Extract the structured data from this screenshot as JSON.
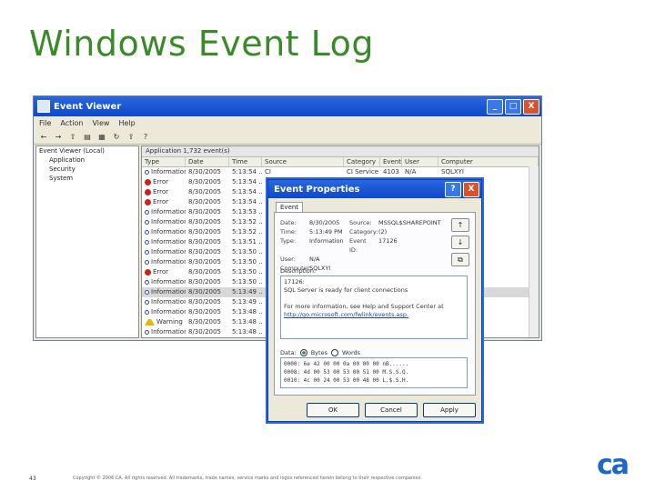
{
  "slide": {
    "title": "Windows Event Log",
    "page_number": "43",
    "copyright": "Copyright © 2006 CA. All rights reserved. All trademarks, trade names, service marks and logos referenced herein belong to their respective companies.",
    "logo_text": "ca"
  },
  "event_viewer": {
    "title": "Event Viewer",
    "window_buttons": {
      "minimize": "_",
      "maximize": "□",
      "close": "X"
    },
    "menu": [
      "File",
      "Action",
      "View",
      "Help"
    ],
    "tree": {
      "root": "Event Viewer (Local)",
      "items": [
        "Application",
        "Security",
        "System"
      ]
    },
    "list_info": "Application    1,732 event(s)",
    "columns": [
      "Type",
      "Date",
      "Time",
      "Source",
      "Category",
      "Event",
      "User",
      "Computer"
    ],
    "rows": [
      {
        "type": "Information",
        "icon": "info",
        "date": "8/30/2005",
        "time": "5:13:54 ...",
        "source": "CI",
        "category": "CI Service",
        "event": "4103",
        "user": "N/A",
        "computer": "SQLXYI"
      },
      {
        "type": "Error",
        "icon": "error",
        "date": "8/30/2005",
        "time": "5:13:54 ...",
        "source": "",
        "category": "",
        "event": "",
        "user": "",
        "computer": ""
      },
      {
        "type": "Error",
        "icon": "error",
        "date": "8/30/2005",
        "time": "5:13:54 ...",
        "source": "",
        "category": "",
        "event": "",
        "user": "",
        "computer": ""
      },
      {
        "type": "Error",
        "icon": "error",
        "date": "8/30/2005",
        "time": "5:13:54 ...",
        "source": "",
        "category": "",
        "event": "",
        "user": "",
        "computer": ""
      },
      {
        "type": "Information",
        "icon": "info",
        "date": "8/30/2005",
        "time": "5:13:53 ...",
        "source": "",
        "category": "",
        "event": "",
        "user": "",
        "computer": ""
      },
      {
        "type": "Information",
        "icon": "info",
        "date": "8/30/2005",
        "time": "5:13:52 ...",
        "source": "",
        "category": "",
        "event": "",
        "user": "",
        "computer": ""
      },
      {
        "type": "Information",
        "icon": "info",
        "date": "8/30/2005",
        "time": "5:13:52 ...",
        "source": "",
        "category": "",
        "event": "",
        "user": "",
        "computer": ""
      },
      {
        "type": "Information",
        "icon": "info",
        "date": "8/30/2005",
        "time": "5:13:51 ...",
        "source": "",
        "category": "",
        "event": "",
        "user": "",
        "computer": ""
      },
      {
        "type": "Information",
        "icon": "info",
        "date": "8/30/2005",
        "time": "5:13:50 ...",
        "source": "",
        "category": "",
        "event": "",
        "user": "",
        "computer": ""
      },
      {
        "type": "Information",
        "icon": "info",
        "date": "8/30/2005",
        "time": "5:13:50 ...",
        "source": "",
        "category": "",
        "event": "",
        "user": "",
        "computer": ""
      },
      {
        "type": "Error",
        "icon": "error",
        "date": "8/30/2005",
        "time": "5:13:50 ...",
        "source": "",
        "category": "",
        "event": "",
        "user": "",
        "computer": ""
      },
      {
        "type": "Information",
        "icon": "info",
        "date": "8/30/2005",
        "time": "5:13:50 ...",
        "source": "",
        "category": "",
        "event": "",
        "user": "",
        "computer": ""
      },
      {
        "type": "Information",
        "icon": "info",
        "date": "8/30/2005",
        "time": "5:13:49 ...",
        "source": "",
        "category": "",
        "event": "",
        "user": "",
        "computer": "",
        "selected": true
      },
      {
        "type": "Information",
        "icon": "info",
        "date": "8/30/2005",
        "time": "5:13:49 ...",
        "source": "",
        "category": "",
        "event": "",
        "user": "",
        "computer": ""
      },
      {
        "type": "Information",
        "icon": "info",
        "date": "8/30/2005",
        "time": "5:13:48 ...",
        "source": "",
        "category": "",
        "event": "",
        "user": "",
        "computer": ""
      },
      {
        "type": "Warning",
        "icon": "warning",
        "date": "8/30/2005",
        "time": "5:13:48 ...",
        "source": "",
        "category": "",
        "event": "",
        "user": "",
        "computer": ""
      },
      {
        "type": "Information",
        "icon": "info",
        "date": "8/30/2005",
        "time": "5:13:48 ...",
        "source": "",
        "category": "",
        "event": "",
        "user": "",
        "computer": ""
      }
    ]
  },
  "event_properties": {
    "title": "Event Properties",
    "help_button": "?",
    "close_button": "X",
    "tab": "Event",
    "fields": [
      {
        "key": "Date:",
        "value": "8/30/2005",
        "key2": "Source:",
        "value2": "MSSQL$SHAREPOINT"
      },
      {
        "key": "Time:",
        "value": "5:13:49 PM",
        "key2": "Category:",
        "value2": "(2)"
      },
      {
        "key": "Type:",
        "value": "Information",
        "key2": "Event ID:",
        "value2": "17126"
      },
      {
        "key": "User:",
        "value": "N/A",
        "key2": "",
        "value2": ""
      },
      {
        "key": "Computer:",
        "value": "SQLXYI",
        "key2": "",
        "value2": ""
      }
    ],
    "nav_buttons": [
      "↑",
      "↓",
      "⧉"
    ],
    "description_label": "Description:",
    "description_lines": [
      "17126:",
      "SQL Server is ready for client connections"
    ],
    "help_text": "For more information, see Help and Support Center at",
    "help_link": "http://go.microsoft.com/fwlink/events.asp.",
    "data_label": "Data:",
    "data_options": [
      "Bytes",
      "Words"
    ],
    "data_lines": [
      "0000: 6e 42 00 00 0a 00 00 00   nB......",
      "0008: 4d 00 53 00 53 00 51 00   M.S.S.Q.",
      "0010: 4c 00 24 00 53 00 48 00   L.$.S.H."
    ],
    "buttons": [
      "OK",
      "Cancel",
      "Apply"
    ]
  }
}
